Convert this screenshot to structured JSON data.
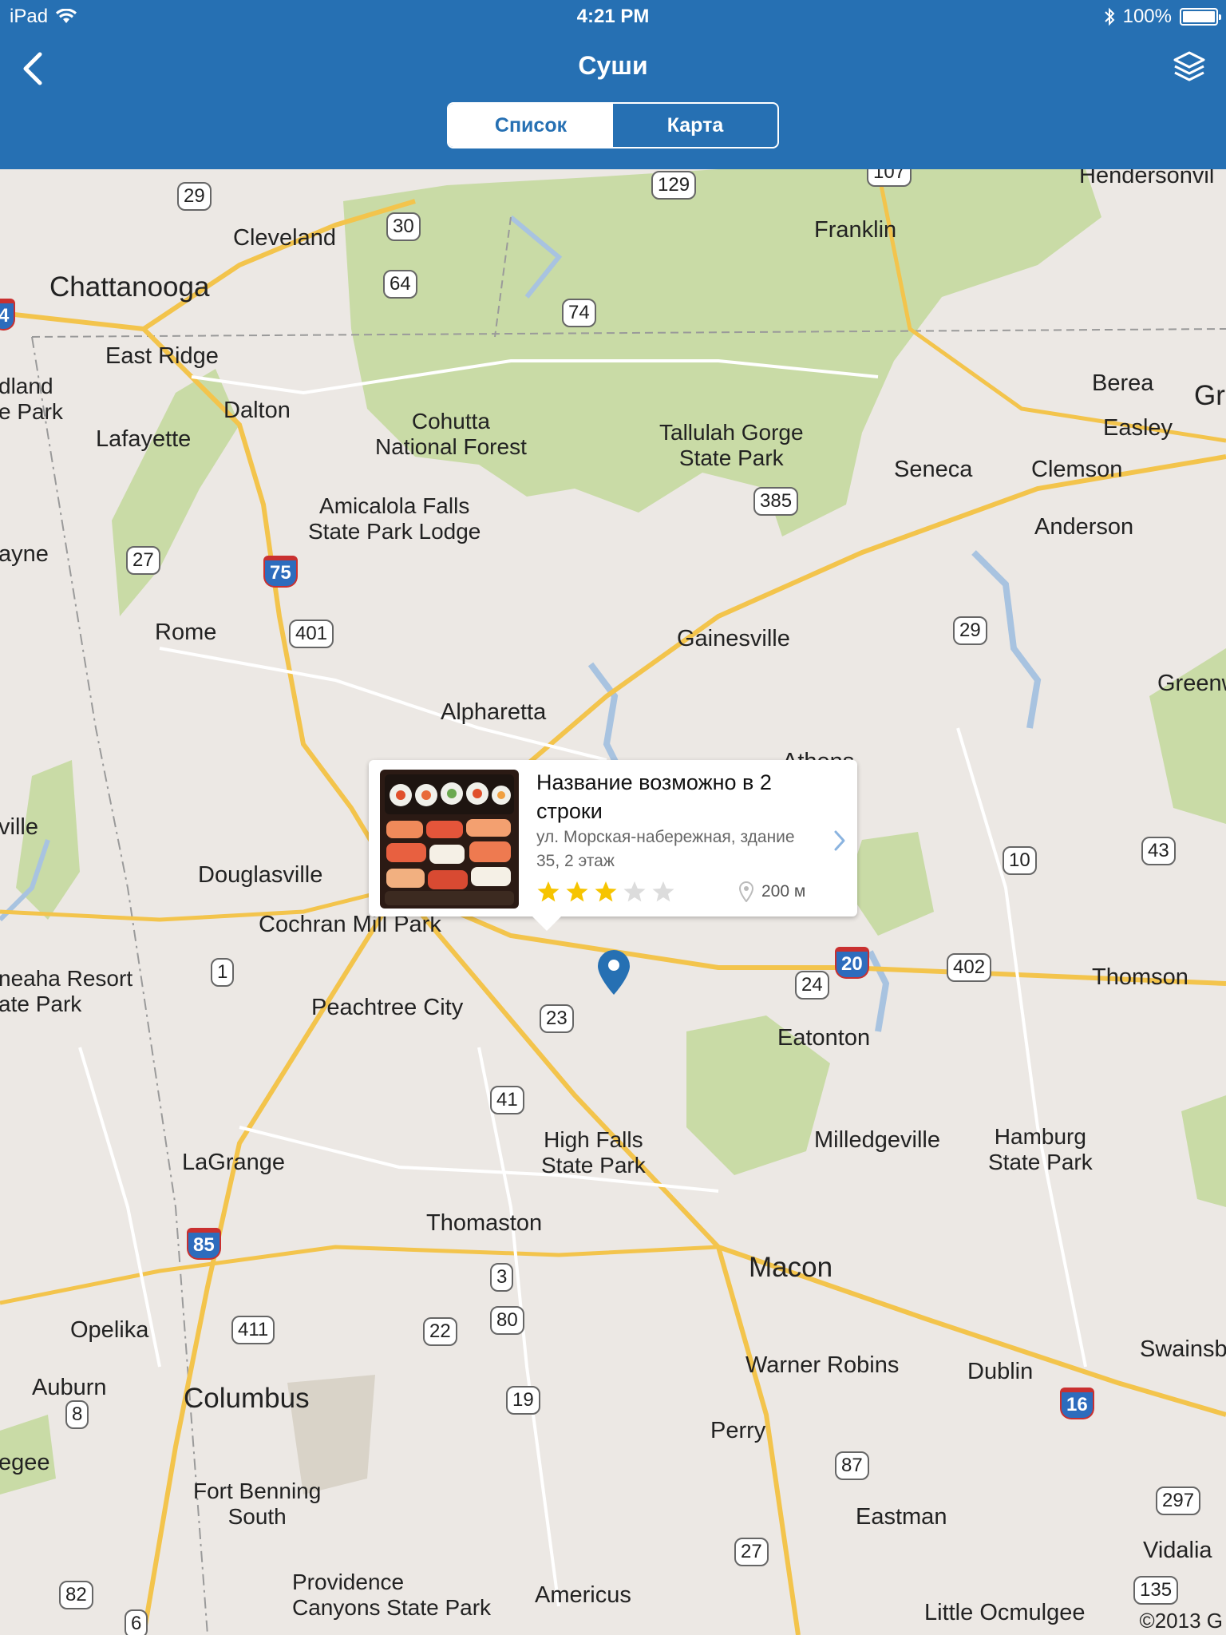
{
  "status_bar": {
    "device": "iPad",
    "time": "4:21 PM",
    "battery": "100%"
  },
  "nav": {
    "title": "Суши",
    "back_icon": "chevron-left-icon",
    "layers_icon": "layers-icon"
  },
  "segments": [
    {
      "label": "Список",
      "selected": true
    },
    {
      "label": "Карта",
      "selected": false
    }
  ],
  "colors": {
    "header": "#2670b3",
    "accent": "#2670b3",
    "star_on": "#f6c400",
    "star_off": "#dcdcdc"
  },
  "callout": {
    "name": "Название возможно в 2 строки",
    "address": "ул. Морская-набережная, здание 35, 2 этаж",
    "rating": 3,
    "rating_max": 5,
    "distance": "200 м"
  },
  "map": {
    "places": [
      {
        "name": "Chattanooga",
        "big": true
      },
      {
        "name": "Cleveland"
      },
      {
        "name": "East Ridge"
      },
      {
        "name": "Dalton"
      },
      {
        "name": "Lafayette"
      },
      {
        "name": "Franklin"
      },
      {
        "name": "Cohutta\nNational Forest",
        "park": true
      },
      {
        "name": "Tallulah Gorge\nState Park",
        "park": true
      },
      {
        "name": "Amicalola Falls\nState Park Lodge",
        "park": true
      },
      {
        "name": "Seneca"
      },
      {
        "name": "Clemson"
      },
      {
        "name": "Berea"
      },
      {
        "name": "Easley"
      },
      {
        "name": "Anderson"
      },
      {
        "name": "Rome"
      },
      {
        "name": "Gainesville"
      },
      {
        "name": "Alpharetta"
      },
      {
        "name": "Greenwo"
      },
      {
        "name": "Athens"
      },
      {
        "name": "Douglasville"
      },
      {
        "name": "Cochran Mill Park"
      },
      {
        "name": "Peachtree City"
      },
      {
        "name": "Eatonton"
      },
      {
        "name": "Thomson"
      },
      {
        "name": "neaha Resort\nate Park",
        "park": true
      },
      {
        "name": "High Falls\nState Park",
        "park": true
      },
      {
        "name": "Milledgeville"
      },
      {
        "name": "Hamburg\nState Park",
        "park": true
      },
      {
        "name": "LaGrange"
      },
      {
        "name": "Thomaston"
      },
      {
        "name": "Macon",
        "big": true
      },
      {
        "name": "Opelika"
      },
      {
        "name": "Auburn"
      },
      {
        "name": "Columbus",
        "big": true
      },
      {
        "name": "Warner Robins"
      },
      {
        "name": "Dublin"
      },
      {
        "name": "Swainsb"
      },
      {
        "name": "Perry"
      },
      {
        "name": "Fort Benning\nSouth",
        "park": true
      },
      {
        "name": "Eastman"
      },
      {
        "name": "Vidalia"
      },
      {
        "name": "Providence\nCanyons State Park",
        "park": true
      },
      {
        "name": "Americus"
      },
      {
        "name": "Little Ocmulgee"
      },
      {
        "name": "dland\ne Park",
        "park": true
      },
      {
        "name": "ayne"
      },
      {
        "name": "ville"
      },
      {
        "name": "egee"
      },
      {
        "name": "Hendersonvil"
      },
      {
        "name": "Gr"
      }
    ],
    "shields": [
      {
        "label": "29"
      },
      {
        "label": "30"
      },
      {
        "label": "64"
      },
      {
        "label": "74"
      },
      {
        "label": "129"
      },
      {
        "label": "27"
      },
      {
        "label": "75",
        "interstate": true
      },
      {
        "label": "401"
      },
      {
        "label": "385"
      },
      {
        "label": "29"
      },
      {
        "label": "10"
      },
      {
        "label": "43"
      },
      {
        "label": "1"
      },
      {
        "label": "23"
      },
      {
        "label": "24"
      },
      {
        "label": "20",
        "interstate": true
      },
      {
        "label": "402"
      },
      {
        "label": "41"
      },
      {
        "label": "85",
        "interstate": true
      },
      {
        "label": "3"
      },
      {
        "label": "80"
      },
      {
        "label": "411"
      },
      {
        "label": "22"
      },
      {
        "label": "8"
      },
      {
        "label": "19"
      },
      {
        "label": "16",
        "interstate": true
      },
      {
        "label": "87"
      },
      {
        "label": "297"
      },
      {
        "label": "27"
      },
      {
        "label": "82"
      },
      {
        "label": "6"
      },
      {
        "label": "135"
      },
      {
        "label": "4",
        "interstate": true
      },
      {
        "label": "107"
      }
    ],
    "copyright": "©2013 G"
  }
}
